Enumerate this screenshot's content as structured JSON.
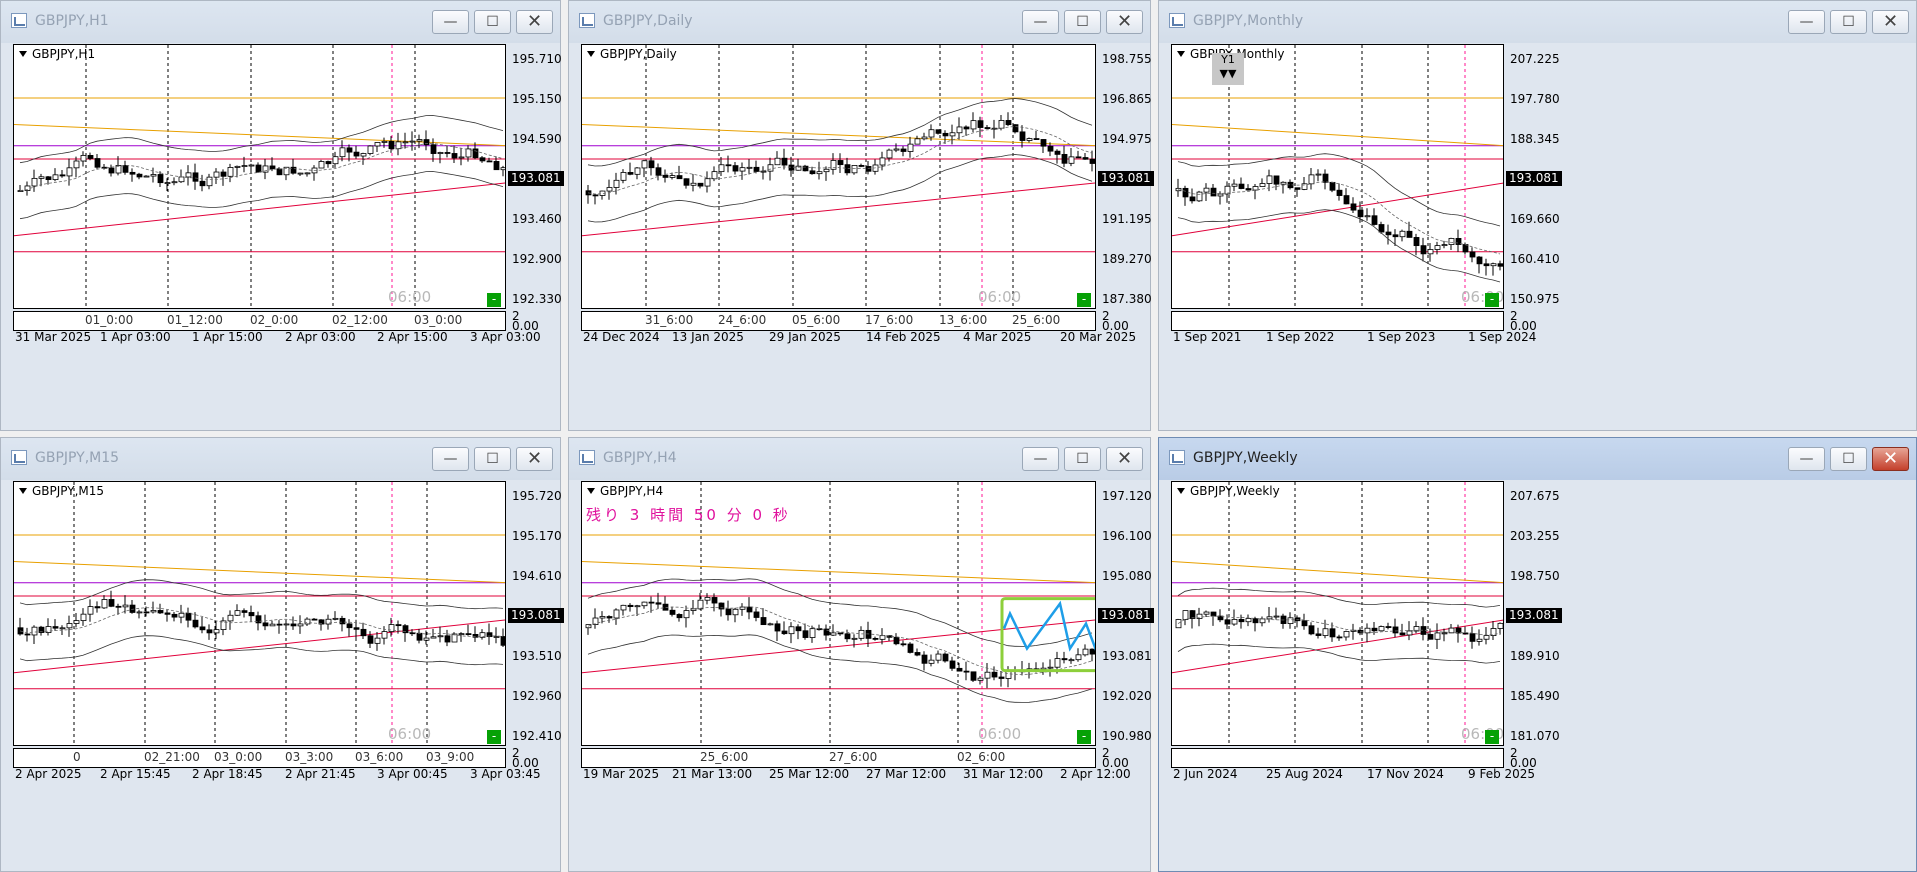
{
  "windows": [
    {
      "id": "h1",
      "title": "GBPJPY,H1",
      "legend": "GBPJPY,H1",
      "active": false,
      "price_levels": [
        "195.710",
        "195.150",
        "194.590",
        "194.020",
        "193.460",
        "192.900",
        "192.330"
      ],
      "current_price": "193.081",
      "overlay_time": "06:00",
      "grid_labels": [
        "01_0:00",
        "01_12:00",
        "02_0:00",
        "02_12:00",
        "03_0:00"
      ],
      "axis_labels": [
        "31 Mar 2025",
        "1 Apr 03:00",
        "1 Apr 15:00",
        "2 Apr 03:00",
        "2 Apr 15:00",
        "3 Apr 03:00"
      ],
      "indicator_scale": [
        "2",
        "0.00"
      ],
      "signal": "-"
    },
    {
      "id": "daily",
      "title": "GBPJPY,Daily",
      "legend": "GBPJPY,Daily",
      "active": false,
      "price_levels": [
        "198.755",
        "196.865",
        "194.975",
        "193.081",
        "191.195",
        "189.270",
        "187.380"
      ],
      "current_price": "193.081",
      "overlay_time": "06:00",
      "grid_labels": [
        "31_6:00",
        "24_6:00",
        "05_6:00",
        "17_6:00",
        "13_6:00",
        "25_6:00"
      ],
      "axis_labels": [
        "24 Dec 2024",
        "13 Jan 2025",
        "29 Jan 2025",
        "14 Feb 2025",
        "4 Mar 2025",
        "20 Mar 2025"
      ],
      "indicator_scale": [
        "2",
        "0.00"
      ],
      "signal": "-"
    },
    {
      "id": "monthly",
      "title": "GBPJPY,Monthly",
      "legend": "GBPJPY,Monthly",
      "active": false,
      "price_levels": [
        "207.225",
        "197.780",
        "188.345",
        "179.095",
        "169.660",
        "160.410",
        "150.975"
      ],
      "current_price": "193.081",
      "overlay_time": "06:00",
      "grid_labels": [],
      "axis_labels": [
        "1 Sep 2021",
        "1 Sep 2022",
        "1 Sep 2023",
        "1 Sep 2024"
      ],
      "indicator_scale": [
        "2",
        "0.00"
      ],
      "signal": "-",
      "y1_label": "Y1"
    },
    {
      "id": "m15",
      "title": "GBPJPY,M15",
      "legend": "GBPJPY,M15",
      "active": false,
      "price_levels": [
        "195.720",
        "195.170",
        "194.610",
        "194.060",
        "193.510",
        "192.960",
        "192.410"
      ],
      "current_price": "193.081",
      "overlay_time": "06:00",
      "grid_labels": [
        "0",
        "02_21:00",
        "03_0:00",
        "03_3:00",
        "03_6:00",
        "03_9:00"
      ],
      "axis_labels": [
        "2 Apr 2025",
        "2 Apr 15:45",
        "2 Apr 18:45",
        "2 Apr 21:45",
        "3 Apr 00:45",
        "3 Apr 03:45"
      ],
      "indicator_scale": [
        "2",
        "0.00"
      ],
      "signal": "-"
    },
    {
      "id": "h4",
      "title": "GBPJPY,H4",
      "legend": "GBPJPY,H4",
      "active": false,
      "countdown": "残り 3 時間 50 分 0 秒",
      "price_levels": [
        "197.120",
        "196.100",
        "195.080",
        "194.060",
        "193.081",
        "192.020",
        "190.980"
      ],
      "current_price": "193.081",
      "overlay_time": "06:00",
      "grid_labels": [
        "25_6:00",
        "27_6:00",
        "02_6:00"
      ],
      "axis_labels": [
        "19 Mar 2025",
        "21 Mar 13:00",
        "25 Mar 12:00",
        "27 Mar 12:00",
        "31 Mar 12:00",
        "2 Apr 12:00"
      ],
      "indicator_scale": [
        "2",
        "0.00"
      ],
      "signal": "-"
    },
    {
      "id": "weekly",
      "title": "GBPJPY,Weekly",
      "legend": "GBPJPY,Weekly",
      "active": true,
      "price_levels": [
        "207.675",
        "203.255",
        "198.750",
        "194.330",
        "189.910",
        "185.490",
        "181.070"
      ],
      "current_price": "193.081",
      "overlay_time": "06:00",
      "grid_labels": [],
      "axis_labels": [
        "2 Jun 2024",
        "25 Aug 2024",
        "17 Nov 2024",
        "9 Feb 2025"
      ],
      "indicator_scale": [
        "2",
        "0.00"
      ],
      "signal": "-"
    }
  ],
  "colors": {
    "bull": "#ffffff",
    "bear": "#000000",
    "pink": "#ff1493",
    "purple": "#a000d0",
    "orange": "#e8a000",
    "red": "#e0003a",
    "blue": "#1e9ee8",
    "green": "#8dcf3b"
  }
}
